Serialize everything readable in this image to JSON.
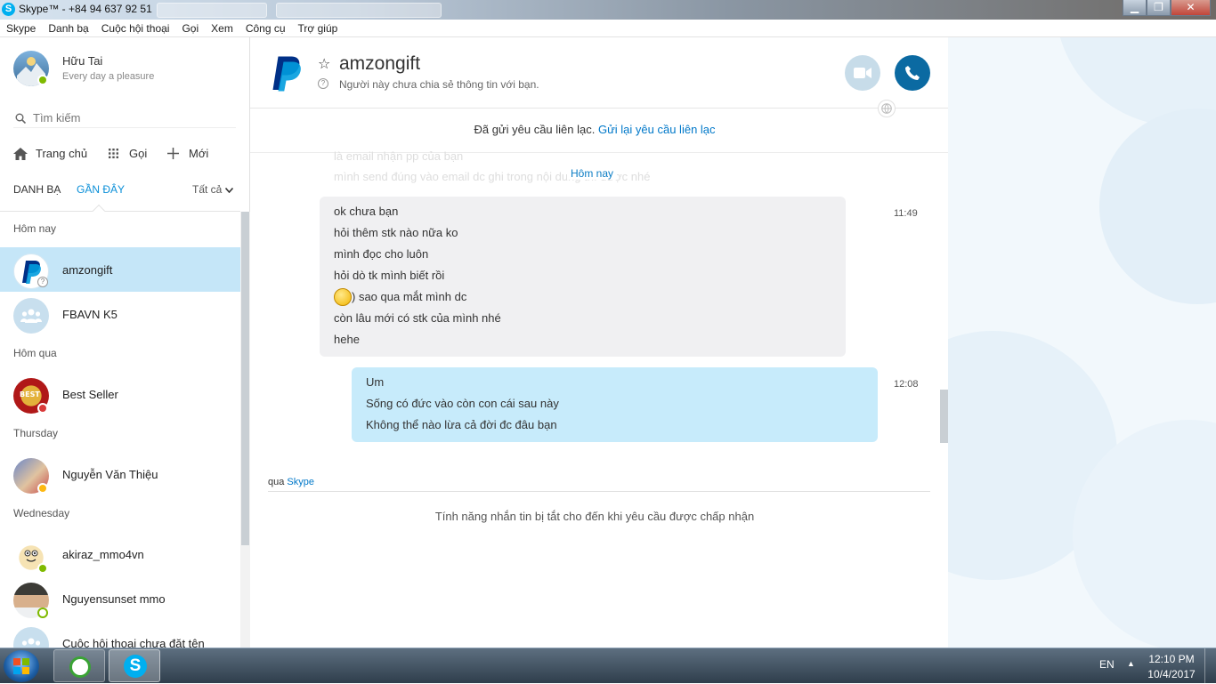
{
  "window": {
    "title": "Skype™ - +84 94 637 92 51",
    "minimize": "▁",
    "maximize": "❐",
    "close": "✕"
  },
  "menu": [
    "Skype",
    "Danh bạ",
    "Cuộc hội thoại",
    "Gọi",
    "Xem",
    "Công cụ",
    "Trợ giúp"
  ],
  "profile": {
    "name": "Hữu Tai",
    "mood": "Every day a pleasure"
  },
  "search": {
    "placeholder": "Tìm kiếm"
  },
  "nav": {
    "home": "Trang chủ",
    "call": "Gọi",
    "new": "Mới"
  },
  "tabs": {
    "contacts": "DANH BẠ",
    "recent": "GẦN ĐÂY",
    "filter": "Tất cả"
  },
  "sections": {
    "today": "Hôm nay",
    "yesterday": "Hôm qua",
    "thursday": "Thursday",
    "wednesday": "Wednesday"
  },
  "conversations": [
    {
      "name": "amzongift",
      "status": "unknown"
    },
    {
      "name": "FBAVN K5",
      "status": "group"
    },
    {
      "name": "Best Seller",
      "status": "dnd"
    },
    {
      "name": "Nguyễn Văn Thiệu",
      "status": "away"
    },
    {
      "name": "akiraz_mmo4vn",
      "status": "online"
    },
    {
      "name": "Nguyensunset mmo",
      "status": "offline"
    },
    {
      "name": "Cuộc hội thoại chưa đặt tên",
      "status": "group"
    }
  ],
  "chat": {
    "contact_name": "amzongift",
    "contact_info": "Người này chưa chia sẻ thông tin với bạn.",
    "request_sent": "Đã gửi yêu cầu liên lạc.",
    "resend_link": "Gửi lại yêu cầu liên lạc",
    "faded_line1": "là email nhận pp của bạn",
    "faded_line2": "mình send đúng vào email dc ghi trong nội dung thì được nhé",
    "date_divider": "Hôm nay",
    "incoming": {
      "time": "11:49",
      "lines": [
        "ok chưa bạn",
        "hỏi thêm stk nào nữa ko",
        "mình đọc cho luôn",
        "hỏi dò tk mình biết rồi",
        ") sao qua mắt mình dc",
        "còn lâu mới có stk của mình nhé",
        "hehe"
      ]
    },
    "outgoing": {
      "time": "12:08",
      "lines": [
        "Um",
        "Sống có đức vào còn con cái sau này",
        "Không thể nào lừa cả đời đc đâu bạn"
      ]
    },
    "via_label": "qua",
    "via_link": "Skype",
    "disabled_notice": "Tính năng nhắn tin bị tắt cho đến khi yêu cầu được chấp nhận"
  },
  "taskbar": {
    "lang": "EN",
    "time": "12:10 PM",
    "date": "10/4/2017"
  },
  "colors": {
    "skype_blue": "#00aff0",
    "link": "#0078c9",
    "selected": "#c5e6f8",
    "call_button": "#0b6aa2"
  }
}
